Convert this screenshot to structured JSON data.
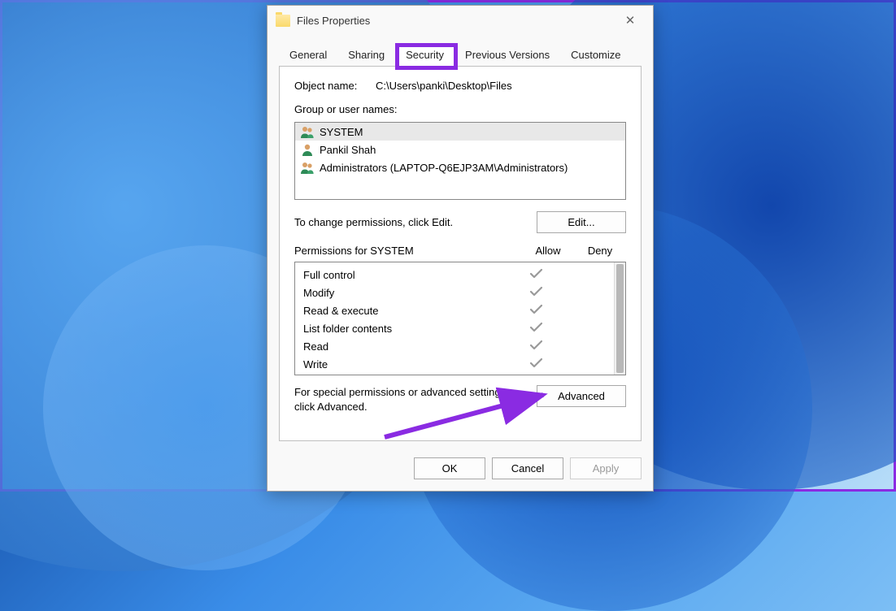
{
  "window": {
    "title": "Files Properties"
  },
  "tabs": {
    "general": "General",
    "sharing": "Sharing",
    "security": "Security",
    "previous_versions": "Previous Versions",
    "customize": "Customize",
    "active": "security"
  },
  "security": {
    "object_name_label": "Object name:",
    "object_name_value": "C:\\Users\\panki\\Desktop\\Files",
    "group_label": "Group or user names:",
    "users": [
      {
        "name": "SYSTEM",
        "type": "group",
        "selected": true
      },
      {
        "name": "Pankil Shah",
        "type": "user",
        "selected": false
      },
      {
        "name": "Administrators (LAPTOP-Q6EJP3AM\\Administrators)",
        "type": "group",
        "selected": false
      }
    ],
    "change_hint": "To change permissions, click Edit.",
    "edit_button": "Edit...",
    "permissions_for_label": "Permissions for SYSTEM",
    "col_allow": "Allow",
    "col_deny": "Deny",
    "permissions": [
      {
        "name": "Full control",
        "allow": true,
        "deny": false
      },
      {
        "name": "Modify",
        "allow": true,
        "deny": false
      },
      {
        "name": "Read & execute",
        "allow": true,
        "deny": false
      },
      {
        "name": "List folder contents",
        "allow": true,
        "deny": false
      },
      {
        "name": "Read",
        "allow": true,
        "deny": false
      },
      {
        "name": "Write",
        "allow": true,
        "deny": false
      }
    ],
    "advanced_hint": "For special permissions or advanced settings, click Advanced.",
    "advanced_button": "Advanced"
  },
  "footer": {
    "ok": "OK",
    "cancel": "Cancel",
    "apply": "Apply"
  },
  "annotation": {
    "highlight_tab": "security",
    "arrow_target": "advanced_button",
    "color": "#8a2be2"
  }
}
